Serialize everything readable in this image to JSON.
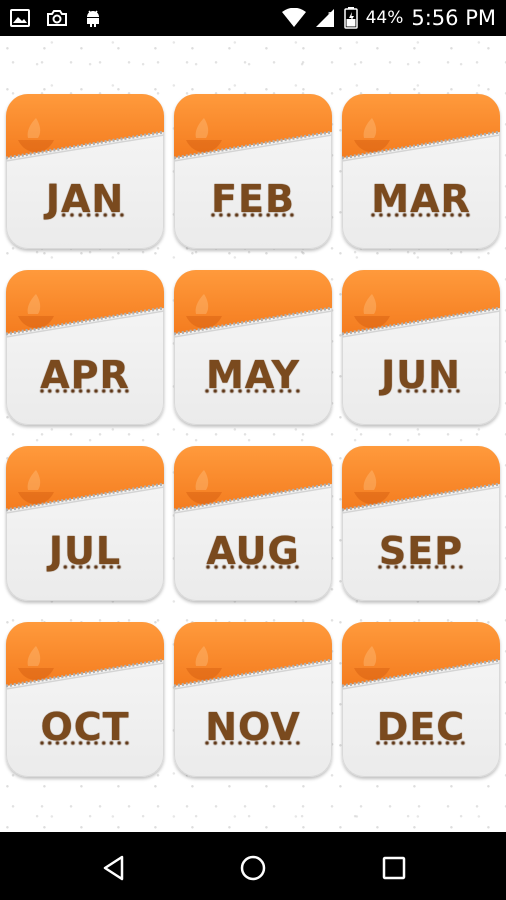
{
  "status_bar": {
    "battery_percent": "44%",
    "time": "5:56 PM",
    "left_icons": [
      "image-icon",
      "camera-icon",
      "android-icon"
    ],
    "right_icons": [
      "wifi-icon",
      "cell-signal-icon",
      "battery-icon"
    ]
  },
  "months": [
    {
      "label": "JAN"
    },
    {
      "label": "FEB"
    },
    {
      "label": "MAR"
    },
    {
      "label": "APR"
    },
    {
      "label": "MAY"
    },
    {
      "label": "JUN"
    },
    {
      "label": "JUL"
    },
    {
      "label": "AUG"
    },
    {
      "label": "SEP"
    },
    {
      "label": "OCT"
    },
    {
      "label": "NOV"
    },
    {
      "label": "DEC"
    }
  ],
  "colors": {
    "tile_orange": "#f47c1f",
    "tile_orange_light": "#ff9a3c",
    "label_brown": "#7a4a1e",
    "tile_body": "#f2f2f2"
  },
  "nav_bar": {
    "buttons": [
      "back-icon",
      "home-icon",
      "recents-icon"
    ]
  }
}
